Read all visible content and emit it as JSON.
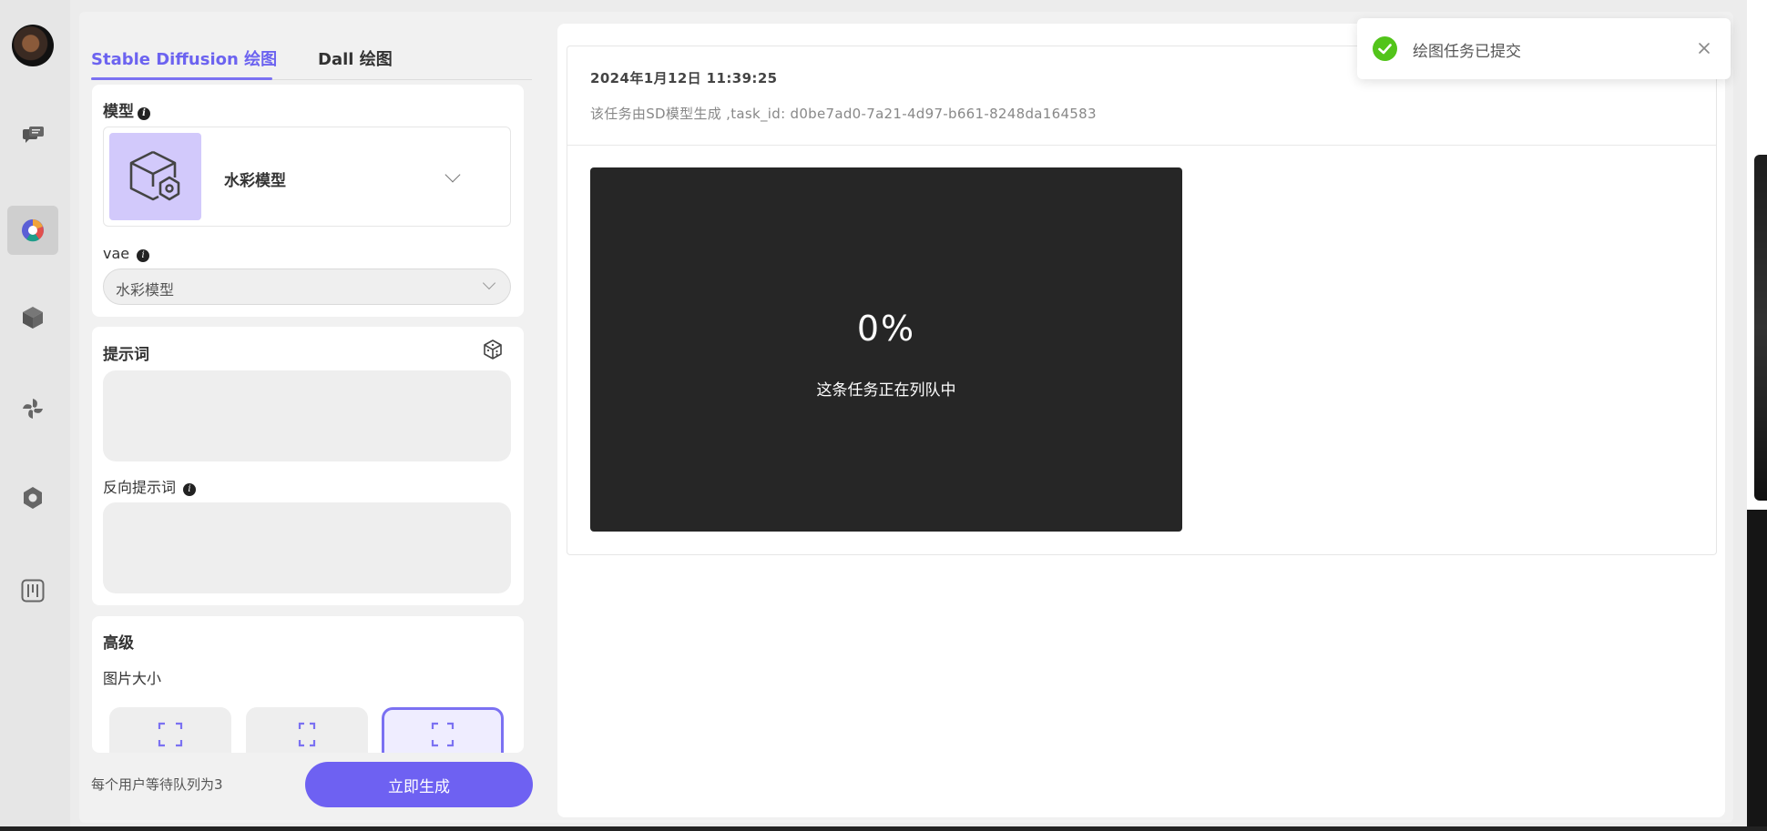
{
  "sidebar": {
    "items": [
      {
        "name": "chat",
        "icon": "chat-bubbles-icon"
      },
      {
        "name": "drawing",
        "icon": "palette-icon",
        "active": true
      },
      {
        "name": "models",
        "icon": "cube-icon"
      },
      {
        "name": "plugins",
        "icon": "pinwheel-icon"
      },
      {
        "name": "settings",
        "icon": "hex-nut-icon"
      },
      {
        "name": "dashboard",
        "icon": "sliders-icon"
      }
    ]
  },
  "tabs": [
    {
      "label": "Stable Diffusion 绘图",
      "active": true
    },
    {
      "label": "Dall 绘图",
      "active": false
    }
  ],
  "model_section": {
    "title": "模型",
    "selected_model": "水彩模型",
    "vae_label": "vae",
    "vae_value": "水彩模型"
  },
  "prompt_section": {
    "title": "提示词",
    "prompt_value": "",
    "negative_label": "反向提示词",
    "negative_value": ""
  },
  "advanced_section": {
    "title": "高级",
    "size_label": "图片大小",
    "size_options_selected_index": 2
  },
  "footer": {
    "queue_note": "每个用户等待队列为3",
    "generate_label": "立即生成"
  },
  "task": {
    "time": "2024年1月12日 11:39:25",
    "description": "该任务由SD模型生成 ,task_id: d0be7ad0-7a21-4d97-b661-8248da164583",
    "progress": "0%",
    "status": "这条任务正在列队中"
  },
  "toast": {
    "message": "绘图任务已提交"
  },
  "colors": {
    "accent": "#6e61f2",
    "success": "#52c41a",
    "queue_bg": "#262626"
  }
}
